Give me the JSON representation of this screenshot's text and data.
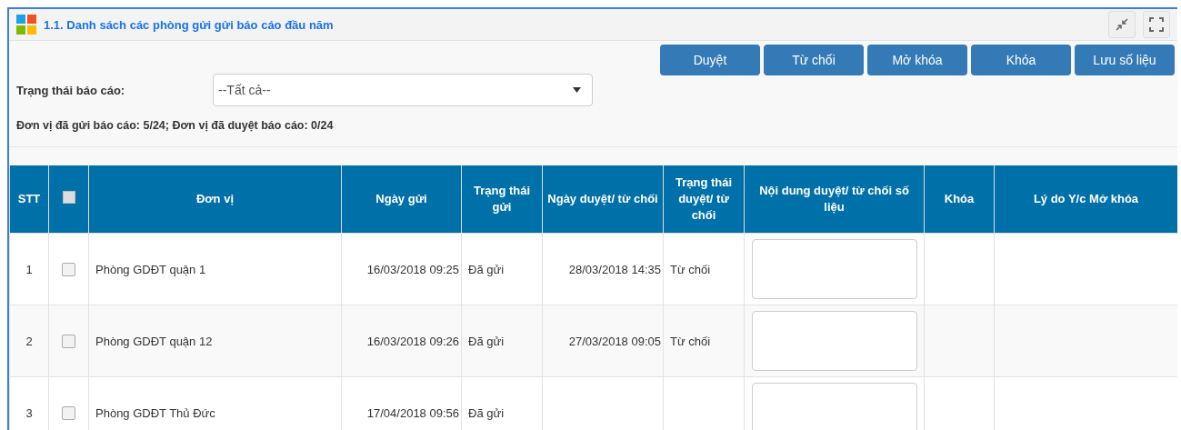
{
  "panel": {
    "title": "1.1. Danh sách các phòng gửi gửi báo cáo đầu năm"
  },
  "buttons": [
    "Duyệt",
    "Từ chối",
    "Mở khóa",
    "Khóa",
    "Lưu số liệu"
  ],
  "filter": {
    "label": "Trạng thái báo cáo:",
    "value": "--Tất cả--"
  },
  "summary": "Đơn vị đã gửi báo cáo: 5/24; Đơn vị đã duyệt báo cáo: 0/24",
  "table": {
    "columns": [
      "STT",
      "",
      "Đơn vị",
      "Ngày gửi",
      "Trạng thái gửi",
      "Ngày duyệt/ từ chối",
      "Trạng thái duyệt/ từ chối",
      "Nội dung duyệt/ từ chối số liệu",
      "Khóa",
      "Lý do Y/c Mở khóa"
    ],
    "header_checked": false,
    "rows": [
      {
        "stt": "1",
        "checked": false,
        "unit": "Phòng GDĐT quận 1",
        "sent": "16/03/2018 09:25",
        "sent_status": "Đã gửi",
        "reviewed": "28/03/2018 14:35",
        "review_status": "Từ chối"
      },
      {
        "stt": "2",
        "checked": false,
        "unit": "Phòng GDĐT quận 12",
        "sent": "16/03/2018 09:26",
        "sent_status": "Đã gửi",
        "reviewed": "27/03/2018 09:05",
        "review_status": "Từ chối"
      },
      {
        "stt": "3",
        "checked": false,
        "unit": "Phòng GDĐT Thủ Đức",
        "sent": "17/04/2018 09:56",
        "sent_status": "Đã gửi"
      }
    ]
  }
}
